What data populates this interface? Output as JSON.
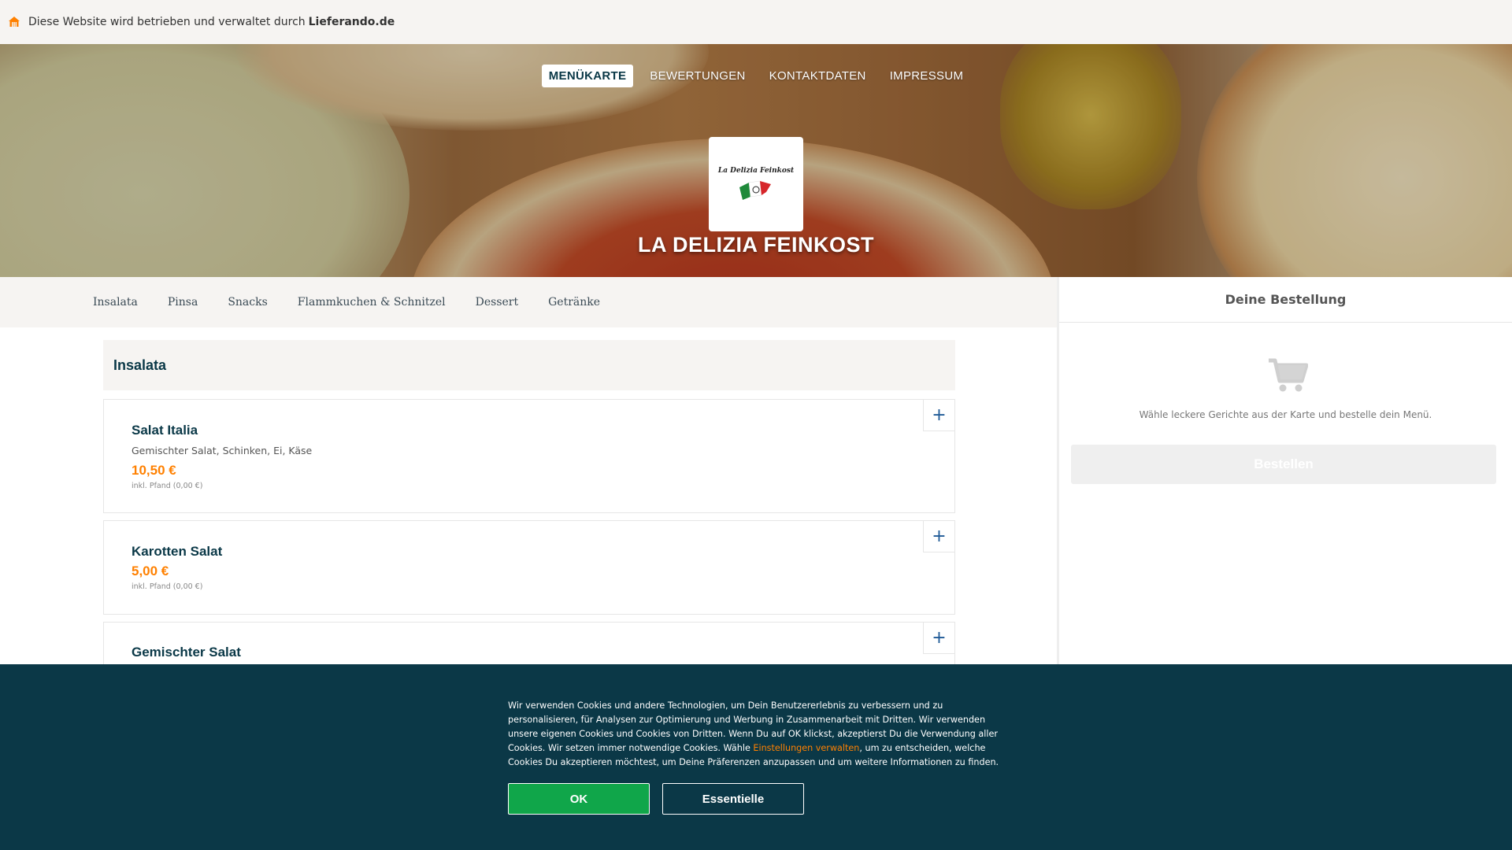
{
  "topbar": {
    "icon": "lieferando-house-icon",
    "text": "Diese Website wird betrieben und verwaltet durch",
    "brand": "Lieferando.de"
  },
  "nav": {
    "items": [
      {
        "label": "MENÜKARTE",
        "active": true
      },
      {
        "label": "BEWERTUNGEN",
        "active": false
      },
      {
        "label": "KONTAKTDATEN",
        "active": false
      },
      {
        "label": "IMPRESSUM",
        "active": false
      }
    ]
  },
  "restaurant": {
    "logo_text": "La Delizia Feinkost",
    "name": "LA DELIZIA FEINKOST"
  },
  "categories": [
    "Insalata",
    "Pinsa",
    "Snacks",
    "Flammkuchen & Schnitzel",
    "Dessert",
    "Getränke"
  ],
  "section": {
    "title": "Insalata",
    "items": [
      {
        "name": "Salat Italia",
        "description": "Gemischter Salat, Schinken, Ei, Käse",
        "price": "10,50 €",
        "pfand": "inkl. Pfand (0,00 €)",
        "add_icon": "plus-icon",
        "add_label": "+"
      },
      {
        "name": "Karotten Salat",
        "description": "",
        "price": "5,00 €",
        "pfand": "inkl. Pfand (0,00 €)",
        "add_icon": "plus-icon",
        "add_label": "+"
      },
      {
        "name": "Gemischter Salat",
        "description": "",
        "price": "",
        "pfand": "",
        "add_icon": "plus-icon",
        "add_label": "+"
      }
    ]
  },
  "sidebar": {
    "title": "Deine Bestellung",
    "cart_icon": "shopping-cart-icon",
    "empty_message": "Wähle leckere Gerichte aus der Karte und bestelle dein Menü.",
    "order_button": "Bestellen"
  },
  "cookie": {
    "text_before": "Wir verwenden Cookies und andere Technologien, um Dein Benutzererlebnis zu verbessern und zu personalisieren, für Analysen zur Optimierung und Werbung in Zusammenarbeit mit Dritten. Wir verwenden unsere eigenen Cookies und Cookies von Dritten. Wenn Du auf OK klickst, akzeptierst Du die Verwendung aller Cookies. Wir setzen immer notwendige Cookies. Wähle ",
    "link": "Einstellungen verwalten",
    "text_after": ", um zu entscheiden, welche Cookies Du akzeptieren möchtest, um Deine Präferenzen anzupassen und um weitere Informationen zu finden.",
    "ok_button": "OK",
    "essential_button": "Essentielle"
  },
  "colors": {
    "accent_orange": "#ff8000",
    "dark_teal": "#0b3847",
    "ok_green": "#10a64a",
    "plus_blue": "#1f5a96"
  }
}
